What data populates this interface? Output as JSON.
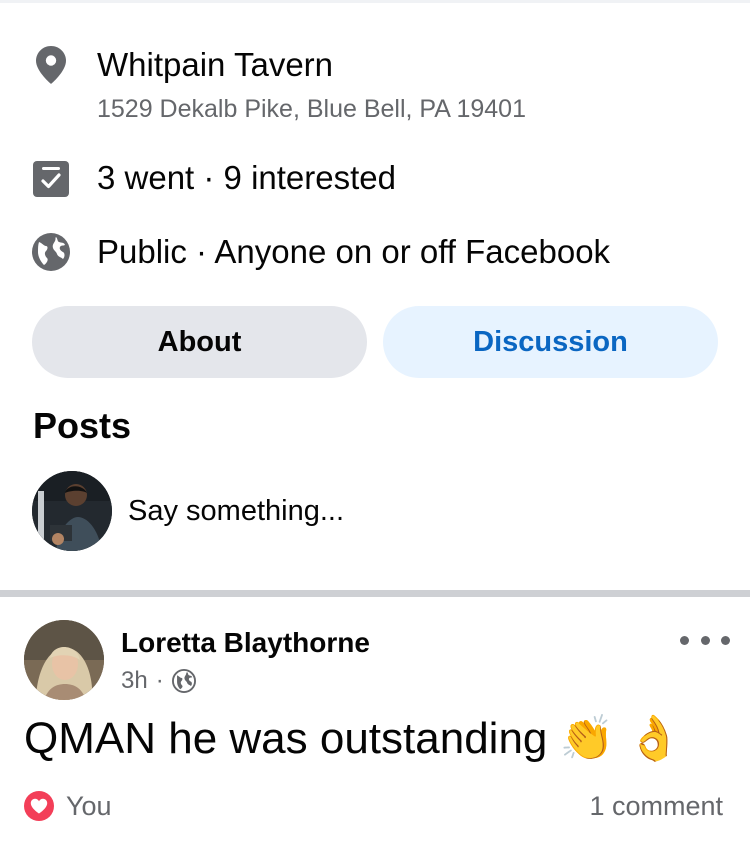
{
  "location": {
    "name": "Whitpain Tavern",
    "address": "1529 Dekalb Pike, Blue Bell, PA 19401",
    "icon": "map-pin-icon"
  },
  "attendance": {
    "text": "3 went · 9 interested",
    "icon": "calendar-check-icon"
  },
  "privacy": {
    "text": "Public · Anyone on or off Facebook",
    "icon": "globe-icon"
  },
  "tabs": [
    {
      "label": "About",
      "active": false
    },
    {
      "label": "Discussion",
      "active": true
    }
  ],
  "posts": {
    "title": "Posts",
    "composer_placeholder": "Say something..."
  },
  "post": {
    "author": "Loretta Blaythorne",
    "time": "3h",
    "separator": "·",
    "audience_icon": "globe-icon",
    "text": "QMAN he was outstanding 👏 👌",
    "reaction_label": "You",
    "reaction_icon": "heart-icon",
    "comments": "1 comment"
  },
  "colors": {
    "accent": "#0a66c2",
    "tab_active_bg": "#e7f3ff",
    "tab_inactive_bg": "#e4e6eb",
    "secondary_text": "#65676b",
    "heart": "#f33e58"
  }
}
